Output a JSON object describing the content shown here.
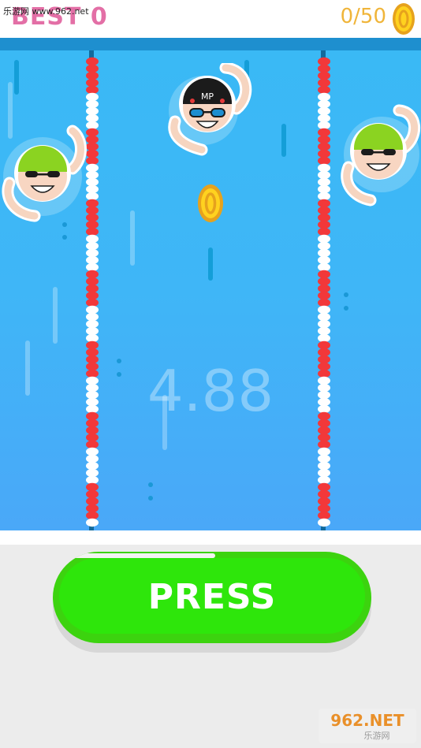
{
  "header": {
    "site_watermark": "乐游网 www.962.net",
    "best_label": "BEST 0",
    "coins_label": "0/50",
    "colors": {
      "best": "#e36fa6",
      "coins": "#f0b53a"
    }
  },
  "game": {
    "timer": "4.88",
    "swimmers": [
      {
        "cap_color": "#8bd321",
        "cap_text": ""
      },
      {
        "cap_color": "#1b1b1b",
        "cap_text": "MP"
      },
      {
        "cap_color": "#8bd321",
        "cap_text": ""
      }
    ],
    "lane_rope_colors": [
      "#f2383a",
      "#ffffff"
    ]
  },
  "controls": {
    "press_label": "PRESS",
    "press_progress": 0.5
  },
  "watermark": {
    "logo_text": "962.NET",
    "logo_subtext": "乐游网"
  },
  "icons": [
    "coin-icon",
    "swimmer-avatar",
    "lane-rope"
  ]
}
